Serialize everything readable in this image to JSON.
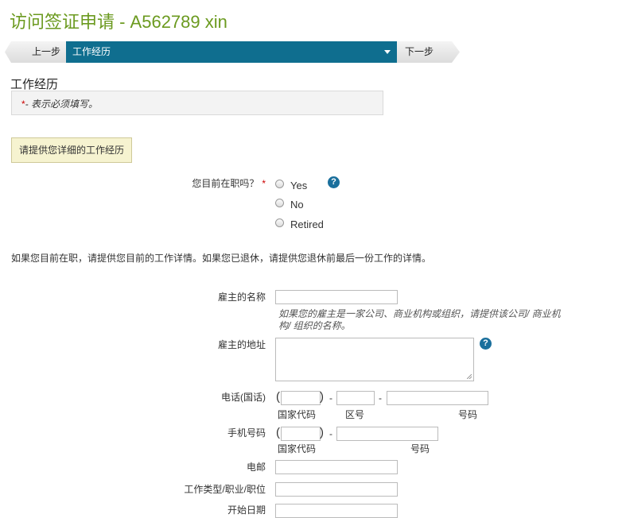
{
  "page": {
    "title": "访问签证申请 - A562789 xin"
  },
  "stepbar": {
    "prev": "上一步",
    "current": "工作经历",
    "next": "下一步"
  },
  "section": {
    "title": "工作经历",
    "required_note_star": "*",
    "required_note_text": "- 表示必须填写。",
    "prompt": "请提供您详细的工作经历"
  },
  "employment": {
    "question": "您目前在职吗？",
    "required_star": "*",
    "options": [
      "Yes",
      "No",
      "Retired"
    ],
    "help_icon": "question-mark"
  },
  "instructions": "如果您目前在职，请提供您目前的工作详情。如果您已退休，请提供您退休前最后一份工作的详情。",
  "fields": {
    "employer_name_label": "雇主的名称",
    "employer_name_value": "",
    "employer_name_hint": "如果您的雇主是一家公司、商业机构或组织，请提供该公司/ 商业机构/ 组织的名称。",
    "employer_address_label": "雇主的地址",
    "employer_address_value": "",
    "phone_label": "电话(国话)",
    "country_code_label": "国家代码",
    "area_code_label": "区号",
    "number_label": "号码",
    "mobile_label": "手机号码",
    "mobile_country_code_label": "国家代码",
    "mobile_number_label": "号码",
    "email_label": "电邮",
    "job_type_label": "工作类型/职业/职位",
    "start_date_label": "开始日期"
  },
  "glyphs": {
    "open_paren": "(",
    "close_paren": ")",
    "dash": "-",
    "help": "?"
  },
  "colors": {
    "title_green": "#6b9a1f",
    "step_blue": "#0f6e8f",
    "help_blue": "#1a6f9c",
    "required_red": "#c00000"
  }
}
